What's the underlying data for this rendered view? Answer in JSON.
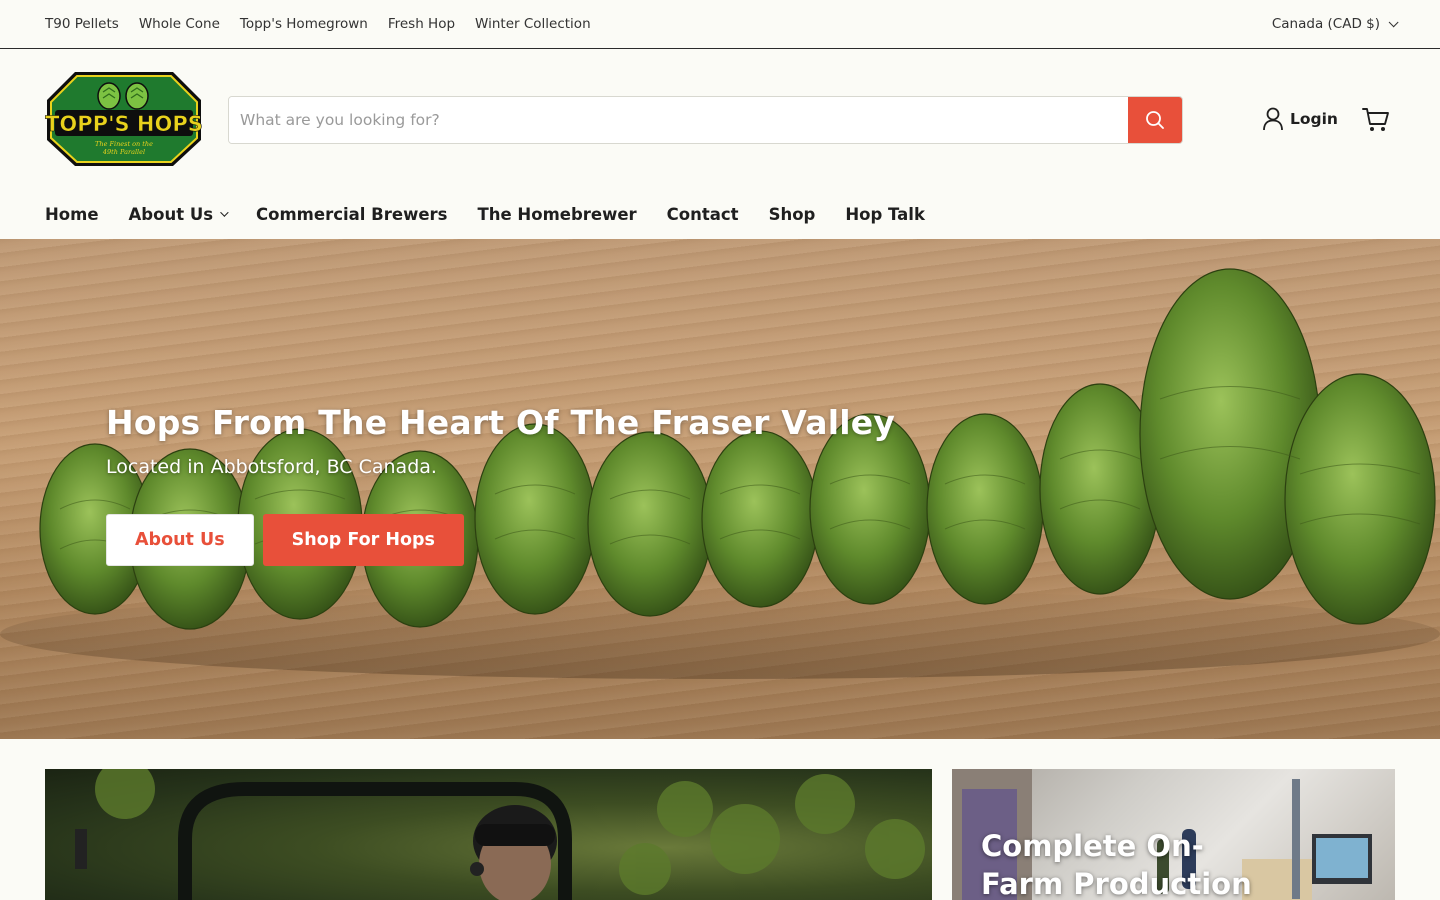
{
  "utility_nav": {
    "links": [
      "T90 Pellets",
      "Whole Cone",
      "Topp's Homegrown",
      "Fresh Hop",
      "Winter Collection"
    ],
    "currency": "Canada (CAD $)"
  },
  "header": {
    "logo_text": "TOPP'S HOPS",
    "logo_tagline": "The Finest on the 49th Parallel",
    "search_placeholder": "What are you looking for?",
    "login_label": "Login"
  },
  "main_nav": {
    "items": [
      "Home",
      "About Us",
      "Commercial Brewers",
      "The Homebrewer",
      "Contact",
      "Shop",
      "Hop Talk"
    ]
  },
  "hero": {
    "title": "Hops From The Heart Of The Fraser Valley",
    "subtitle": "Located in Abbotsford, BC Canada.",
    "about_button": "About Us",
    "shop_button": "Shop For Hops"
  },
  "cards": {
    "card2_title": "Complete On-Farm Production"
  },
  "colors": {
    "accent": "#e8503a",
    "logo_green": "#1f7a2e",
    "logo_yellow": "#e9d21c"
  }
}
